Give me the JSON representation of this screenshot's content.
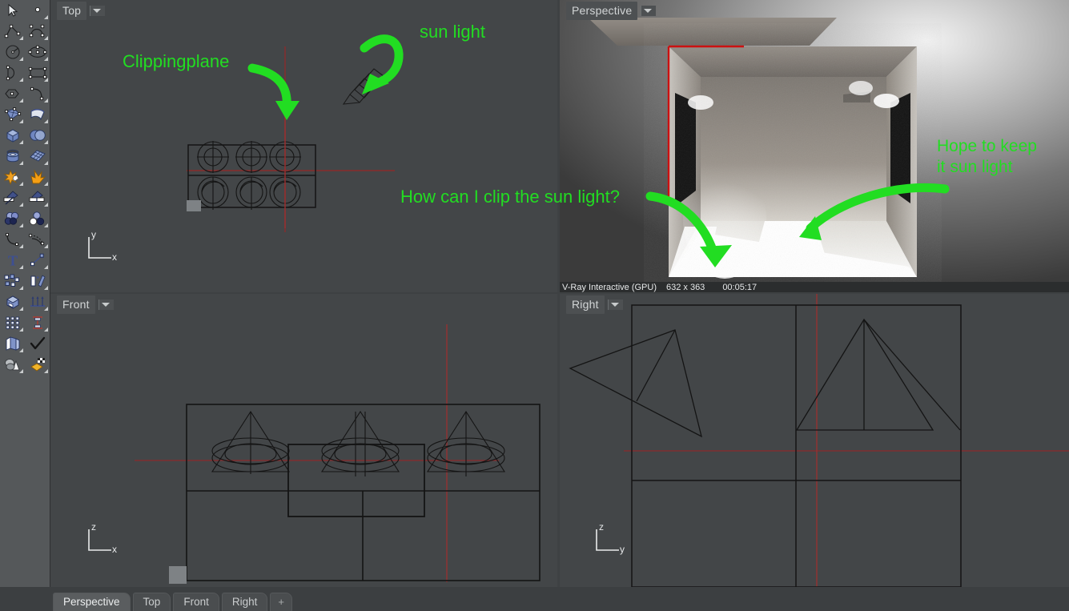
{
  "app": {
    "background": "#3e4143",
    "viewport_bg": "#434648",
    "annotation_color": "#22dd22",
    "cplane_color": "#8a2b2b"
  },
  "toolbar": {
    "name": "rhino-main-toolbar",
    "tools": [
      {
        "row": 0,
        "left": "select-arrow-icon",
        "right": "point-icon"
      },
      {
        "row": 1,
        "left": "polyline-icon",
        "right": "control-point-curve-icon"
      },
      {
        "row": 2,
        "left": "circle-icon",
        "right": "ellipse-icon"
      },
      {
        "row": 3,
        "left": "arc-icon",
        "right": "rectangle-icon"
      },
      {
        "row": 4,
        "left": "polygon-icon",
        "right": "curve-blend-icon"
      },
      {
        "row": 5,
        "left": "surface-from-points-icon",
        "right": "surface-sweep-icon"
      },
      {
        "row": 6,
        "left": "box-solid-icon",
        "right": "sphere-boolean-icon"
      },
      {
        "row": 7,
        "left": "cylinder-icon",
        "right": "surface-grid-icon"
      },
      {
        "row": 8,
        "left": "explode-icon",
        "right": "mesh-from-surface-icon"
      },
      {
        "row": 9,
        "left": "trim-icon",
        "right": "split-icon"
      },
      {
        "row": 10,
        "left": "boolean-union-icon",
        "right": "boolean-difference-icon"
      },
      {
        "row": 11,
        "left": "fillet-curve-icon",
        "right": "offset-curve-icon"
      },
      {
        "row": 12,
        "left": "text-object-icon",
        "right": "scale-icon"
      },
      {
        "row": 13,
        "left": "group-icon",
        "right": "mirror-icon"
      },
      {
        "row": 14,
        "left": "block-icon",
        "right": "array-icon"
      },
      {
        "row": 15,
        "left": "grid-array-icon",
        "right": "dimension-icon"
      },
      {
        "row": 16,
        "left": "layer-icon",
        "right": "check-objects-icon"
      },
      {
        "row": 17,
        "left": "shaded-view-icon",
        "right": "render-icon"
      }
    ]
  },
  "viewports": [
    {
      "id": "vp-top",
      "title": "Top",
      "caret": "chevron-down-icon",
      "axis": {
        "vertical": "y",
        "horizontal": "x"
      }
    },
    {
      "id": "vp-perspective",
      "title": "Perspective",
      "caret": "chevron-down-icon",
      "render_status": {
        "engine": "V-Ray Interactive (GPU)",
        "resolution": "632 x 363",
        "elapsed": "00:05:17"
      }
    },
    {
      "id": "vp-front",
      "title": "Front",
      "caret": "chevron-down-icon",
      "axis": {
        "vertical": "z",
        "horizontal": "x"
      }
    },
    {
      "id": "vp-right",
      "title": "Right",
      "caret": "chevron-down-icon",
      "axis": {
        "vertical": "z",
        "horizontal": "y"
      }
    }
  ],
  "annotations": [
    {
      "id": "clippingplane",
      "text": "Clippingplane",
      "viewport": "Top"
    },
    {
      "id": "sun-light",
      "text": "sun light",
      "viewport": "Top"
    },
    {
      "id": "question",
      "text": "How can I clip the sun light?",
      "viewport": "Top"
    },
    {
      "id": "hope-line1",
      "text": "Hope to keep",
      "viewport": "Perspective"
    },
    {
      "id": "hope-line2",
      "text": "it sun light",
      "viewport": "Perspective"
    }
  ],
  "tabs": {
    "items": [
      {
        "label": "Perspective",
        "active": true
      },
      {
        "label": "Top",
        "active": false
      },
      {
        "label": "Front",
        "active": false
      },
      {
        "label": "Right",
        "active": false
      }
    ],
    "add_label": "+"
  }
}
